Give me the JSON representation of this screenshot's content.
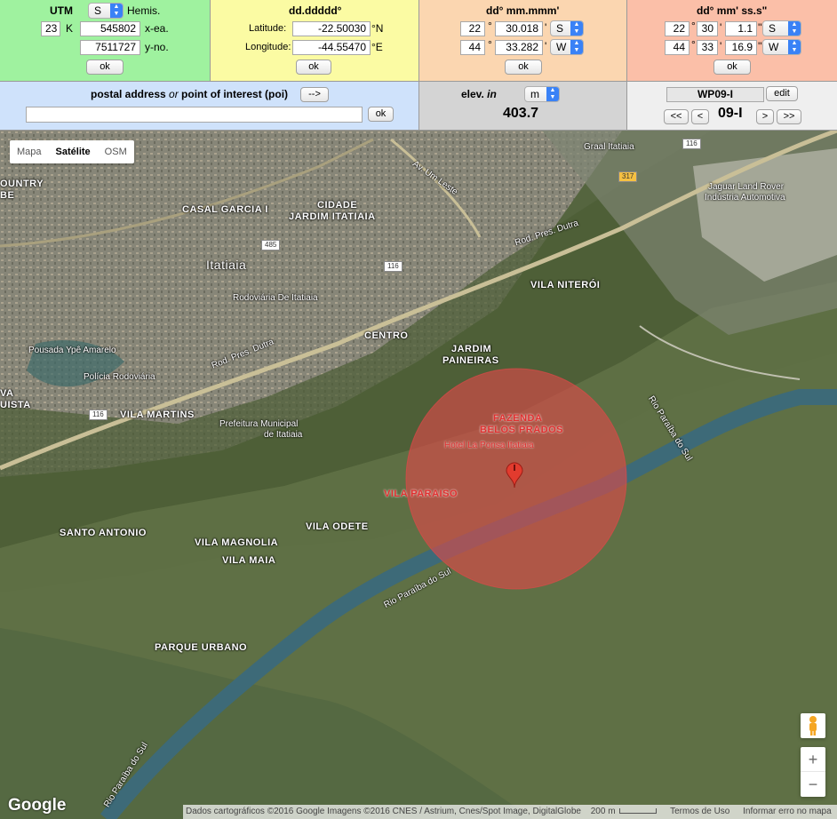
{
  "utm": {
    "title": "UTM",
    "hemis_value": "S",
    "hemis_label": "Hemis.",
    "zone": "23",
    "zone_letter": "K",
    "easting": "545802",
    "easting_label": "x-ea.",
    "northing": "7511727",
    "northing_label": "y-no.",
    "ok": "ok"
  },
  "dd": {
    "title": "dd.ddddd°",
    "lat_label": "Latitude:",
    "lat_value": "-22.50030",
    "lat_unit": "°N",
    "lon_label": "Longitude:",
    "lon_value": "-44.55470",
    "lon_unit": "°E",
    "ok": "ok"
  },
  "ddm": {
    "title": "dd° mm.mmm'",
    "lat_deg": "22",
    "lat_min": "30.018",
    "lat_hemi": "S",
    "lon_deg": "44",
    "lon_min": "33.282",
    "lon_hemi": "W",
    "deg_sym": "°",
    "min_sym": "'",
    "ok": "ok"
  },
  "dms": {
    "title": "dd° mm' ss.s\"",
    "lat_deg": "22",
    "lat_min": "30",
    "lat_sec": "1.1",
    "lat_hemi": "S",
    "lon_deg": "44",
    "lon_min": "33",
    "lon_sec": "16.9",
    "lon_hemi": "W",
    "deg_sym": "°",
    "min_sym": "'",
    "sec_sym": "''",
    "ok": "ok"
  },
  "address": {
    "title_pre": "postal address ",
    "title_or": "or",
    "title_post": "  point of interest (poi)",
    "arrow_btn": "-->",
    "value": "",
    "ok": "ok"
  },
  "elev": {
    "label_pre": "elev. ",
    "label_in": "in",
    "unit": "m",
    "value": "403.7"
  },
  "waypoint": {
    "name": "WP09-I",
    "edit": "edit",
    "first": "<<",
    "prev": "<",
    "label": "09-I",
    "next": ">",
    "last": ">>"
  },
  "map": {
    "tabs": [
      "Mapa",
      "Satélite",
      "OSM"
    ],
    "active_tab": "Satélite",
    "labels": {
      "cidade": "CIDADE",
      "jardim_itatiaia": "JARDIM ITATIAIA",
      "casal_garcia": "CASAL GARCIA I",
      "itatiaia": "Itatiaia",
      "rodoviaria": "Rodoviária De Itatiaia",
      "country": "OUNTRY",
      "country2": "BE",
      "pousada": "Pousada Ypê Amarelo",
      "policia": "Polícia Rodoviária",
      "centro": "CENTRO",
      "jardim_paineiras_1": "JARDIM",
      "jardim_paineiras_2": "PAINEIRAS",
      "vila_niteroi": "VILA NITERÓI",
      "vila_martins": "VILA MARTINS",
      "prefeitura_1": "Prefeitura Municipal",
      "prefeitura_2": "de Itatiaia",
      "va": "VA",
      "uista": "UISTA",
      "fazenda_1": "FAZENDA",
      "fazenda_2": "BELOS PRADOS",
      "hotel": "Hotel La Ponsa Itatiaia",
      "vila_paraiso": "VILA PARAISO",
      "santo_antonio": "SANTO ANTONIO",
      "vila_magnolia": "VILA MAGNOLIA",
      "vila_maia": "VILA MAIA",
      "vila_odete": "VILA ODETE",
      "parque_urbano": "PARQUE URBANO",
      "rio_paraiba_1": "Rio Paraíba do Sul",
      "rio_paraiba_2": "Rio Paraíba do Sul",
      "rio_paraiba_3": "Rio Paraíba do Sul",
      "av_um_leste": "Av. Um Leste",
      "rod_dutra_1": "Rod. Pres. Dutra",
      "rod_dutra_2": "Rod. Pres. Dutra",
      "graal": "Graal Itatiaia",
      "jaguar_1": "Jaguar Land Rover",
      "jaguar_2": "Indústria Automotiva",
      "marker": "I"
    },
    "shields": {
      "s116_a": "116",
      "s116_b": "116",
      "s116_c": "116",
      "s485": "485",
      "s317": "317"
    },
    "google_logo": "Google",
    "attribution": "Dados cartográficos ©2016 Google Imagens ©2016 CNES / Astrium, Cnes/Spot Image, DigitalGlobe",
    "scale": "200 m",
    "terms": "Termos de Uso",
    "report": "Informar erro no mapa",
    "zoom_in": "+",
    "zoom_out": "−"
  },
  "colors": {
    "utm_bg": "#9ff29f",
    "dd_bg": "#fbfba3",
    "ddm_bg": "#fbd6b0",
    "dms_bg": "#fbbfa8",
    "addr_bg": "#cfe2fb",
    "elev_bg": "#d4d4d4",
    "wp_bg": "#efefef",
    "circle": "#e04848"
  }
}
